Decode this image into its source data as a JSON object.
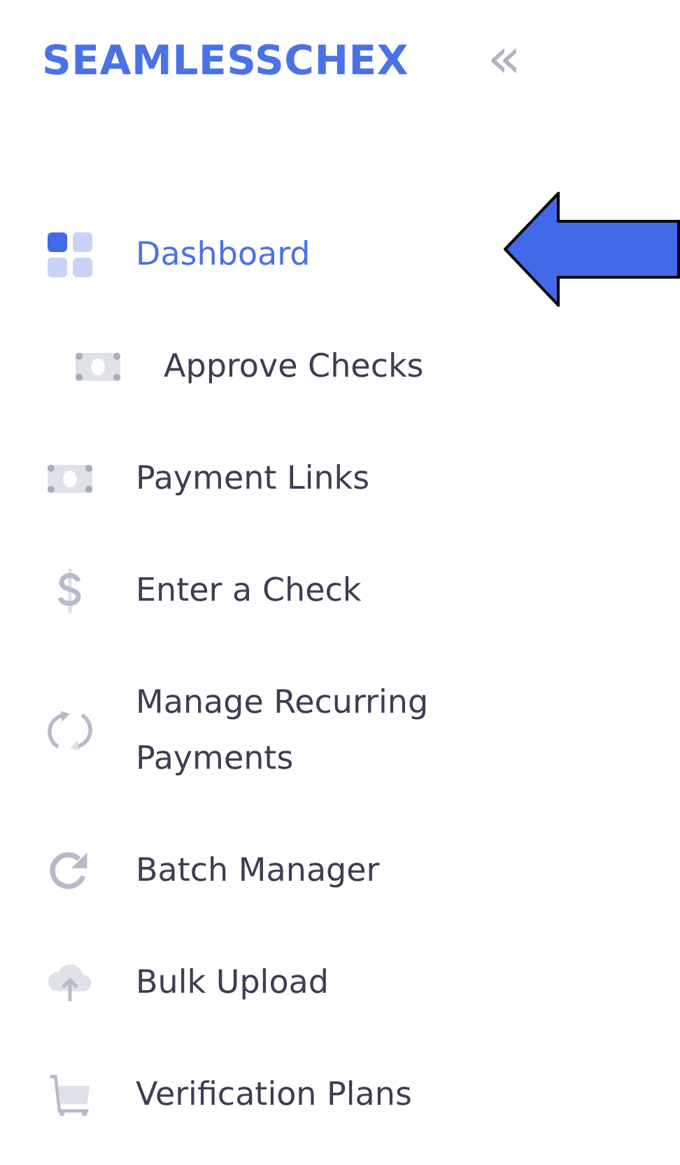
{
  "sidebar": {
    "logo": "SEAMLESSCHEX",
    "collapse_button": "«",
    "items": [
      {
        "label": "Dashboard",
        "kind": "grid",
        "selected": true,
        "children": [
          {
            "label": "Approve Checks",
            "kind": "cash",
            "selected": false
          }
        ]
      },
      {
        "label": "Payment Links",
        "kind": "cash",
        "selected": false
      },
      {
        "label": "Enter a Check",
        "kind": "dollar",
        "selected": false
      },
      {
        "label": "Manage Recurring Payments",
        "kind": "sync",
        "selected": false
      },
      {
        "label": "Batch Manager",
        "kind": "refresh",
        "selected": false
      },
      {
        "label": "Bulk Upload",
        "kind": "cloud",
        "selected": false
      },
      {
        "label": "Verification Plans",
        "kind": "cart",
        "selected": false
      }
    ]
  }
}
